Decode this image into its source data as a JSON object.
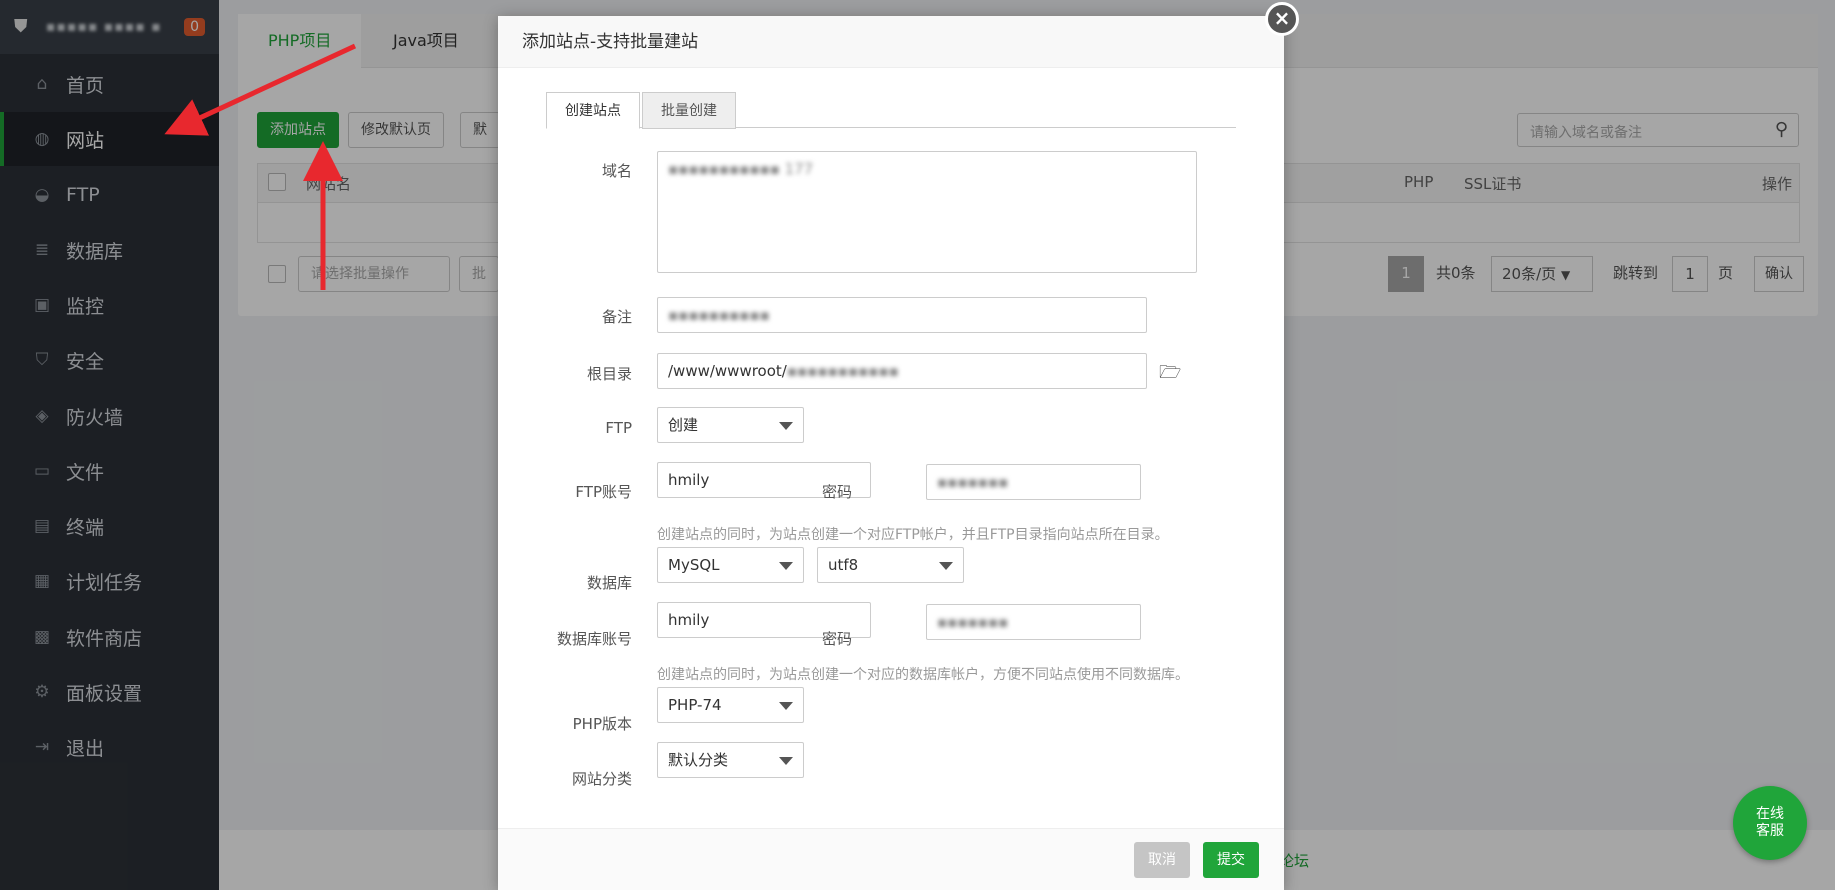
{
  "sidebar": {
    "host": "▪▪▪▪▪ ▪▪▪▪ ▪",
    "badge": "0",
    "items": [
      {
        "label": "首页",
        "icon": "home-icon",
        "glyph": "⌂"
      },
      {
        "label": "网站",
        "icon": "globe-icon",
        "glyph": "◍"
      },
      {
        "label": "FTP",
        "icon": "ftp-icon",
        "glyph": "◒"
      },
      {
        "label": "数据库",
        "icon": "database-icon",
        "glyph": "≣"
      },
      {
        "label": "监控",
        "icon": "monitor-icon",
        "glyph": "▣"
      },
      {
        "label": "安全",
        "icon": "shield-icon",
        "glyph": "⛉"
      },
      {
        "label": "防火墙",
        "icon": "firewall-icon",
        "glyph": "◈"
      },
      {
        "label": "文件",
        "icon": "folder-icon",
        "glyph": "▭"
      },
      {
        "label": "终端",
        "icon": "terminal-icon",
        "glyph": "▤"
      },
      {
        "label": "计划任务",
        "icon": "calendar-icon",
        "glyph": "▦"
      },
      {
        "label": "软件商店",
        "icon": "apps-icon",
        "glyph": "▩"
      },
      {
        "label": "面板设置",
        "icon": "gear-icon",
        "glyph": "⚙"
      },
      {
        "label": "退出",
        "icon": "logout-icon",
        "glyph": "⇥"
      }
    ],
    "active_index": 1
  },
  "main": {
    "tabs": [
      "PHP项目",
      "Java项目"
    ],
    "buttons": {
      "add_site": "添加站点",
      "modify_default": "修改默认页",
      "default": "默认"
    },
    "table_headers": {
      "site_name": "网站名",
      "php": "PHP",
      "ssl": "SSL证书",
      "actions": "操作"
    },
    "search_placeholder": "请输入域名或备注",
    "batch_select": "请选择批量操作",
    "batch_btn": "批量",
    "pager": {
      "page": "1",
      "total": "共0条",
      "per_page": "20条/页",
      "jump_label": "跳转到",
      "jump_value": "1",
      "page_unit": "页",
      "confirm": "确认"
    },
    "footer_link": "论坛"
  },
  "modal": {
    "title": "添加站点-支持批量建站",
    "tabs": [
      "创建站点",
      "批量创建"
    ],
    "domain_label": "域名",
    "domain_value": "▪▪▪▪▪▪▪▪▪▪▪ 177",
    "remark_label": "备注",
    "remark_value": "▪▪▪▪▪▪▪▪▪▪",
    "root_label": "根目录",
    "root_value": "/www/wwwroot/",
    "root_blur": "▪▪▪▪▪▪▪▪▪▪▪",
    "ftp_label": "FTP",
    "ftp_value": "创建",
    "ftp_account_label": "FTP账号",
    "ftp_account_value": "hmily",
    "ftp_password_label": "密码",
    "ftp_password_value": "▪▪▪▪▪▪▪",
    "ftp_hint": "创建站点的同时，为站点创建一个对应FTP帐户，并且FTP目录指向站点所在目录。",
    "db_label": "数据库",
    "db_type": "MySQL",
    "db_charset": "utf8",
    "db_account_label": "数据库账号",
    "db_account_value": "hmily",
    "db_password_label": "密码",
    "db_password_value": "▪▪▪▪▪▪▪",
    "db_hint": "创建站点的同时，为站点创建一个对应的数据库帐户，方便不同站点使用不同数据库。",
    "php_label": "PHP版本",
    "php_value": "PHP-74",
    "category_label": "网站分类",
    "category_value": "默认分类",
    "cancel": "取消",
    "submit": "提交"
  },
  "chat": {
    "line1": "在线",
    "line2": "客服"
  },
  "colors": {
    "accent": "#20a53a",
    "sidebar": "#2c3138",
    "arrow": "#e8282e"
  }
}
